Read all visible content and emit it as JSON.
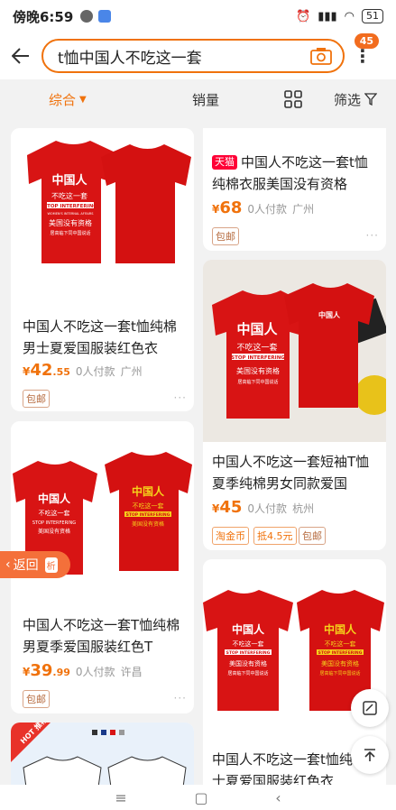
{
  "status": {
    "time": "傍晚6:59",
    "battery": "51"
  },
  "search": {
    "query": "t恤中国人不吃这一套",
    "more_badge": "45"
  },
  "filters": {
    "zonghe": "综合",
    "xiaoliang": "销量",
    "shaixuan": "筛选"
  },
  "products": [
    {
      "title": "中国人不吃这一套t恤纯棉男士夏爱国服装红色衣",
      "price_int": "42",
      "price_dec": ".55",
      "sold": "0人付款",
      "location": "广州",
      "tags": [
        "包邮"
      ]
    },
    {
      "tmall": "天猫",
      "title": "中国人不吃这一套t恤纯棉衣服美国没有资格",
      "price_int": "68",
      "price_dec": "",
      "sold": "0人付款",
      "location": "广州",
      "tags": [
        "包邮"
      ]
    },
    {
      "title": "中国人不吃这一套短袖T恤夏季纯棉男女同款爱国",
      "price_int": "45",
      "price_dec": "",
      "sold": "0人付款",
      "location": "杭州",
      "tags": [
        "淘金币",
        "抵4.5元",
        "包邮"
      ]
    },
    {
      "title": "中国人不吃这一套T恤纯棉男夏季爱国服装红色T",
      "price_int": "39",
      "price_dec": ".99",
      "sold": "0人付款",
      "location": "许昌",
      "tags": [
        "包邮"
      ]
    },
    {
      "title": "中国人不吃这一套t恤纯棉男士夏爱国服装红色衣",
      "price_int": "",
      "price_dec": "",
      "sold": "",
      "location": "",
      "tags": []
    }
  ],
  "shirt_text": {
    "line1": "中国人",
    "line2": "不吃这一套",
    "line3": "STOP INTERFERING",
    "line4": "WOMEN'S INTERNAL AFFAIRS",
    "line5": "美国没有资格",
    "line6": "居高临下同中国说话"
  },
  "price_currency": "¥",
  "return_btn": {
    "label": "返回",
    "icon_text": "析"
  },
  "hot_label": "HOT 推荐",
  "colors": {
    "accent": "#f0720c",
    "tee_red": "#d81414",
    "tmall": "#ff0036"
  }
}
